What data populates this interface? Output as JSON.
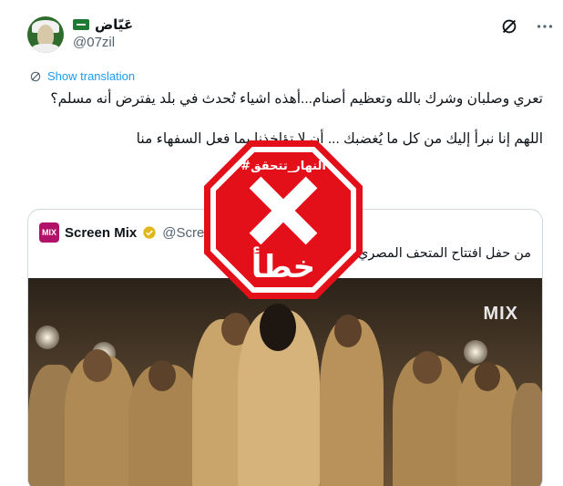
{
  "author": {
    "display_name": "عَيّاض",
    "handle": "@07zil"
  },
  "actions": {
    "show_translation": "Show translation"
  },
  "tweet": {
    "paragraph_1": "تعري وصلبان وشرك بالله وتعظيم أصنام...أهذه اشياء تُحدث في بلد يفترض أنه مسلم؟",
    "paragraph_2": "اللهم إنا نبرأ إليك من كل ما يُغضبك ... أن لا تؤاخذنا بما فعل السفهاء منا"
  },
  "quoted": {
    "logo_text": "MIX",
    "name": "Screen Mix",
    "handle": "@Scre",
    "text": "من حفل افتتاح المتحف المصري",
    "image_watermark": "MIX"
  },
  "stamp": {
    "tag": "#النهار_تتحقق",
    "verdict": "خطأ",
    "color": "#e3101a"
  },
  "colors": {
    "link": "#1d9bf0",
    "muted": "#536471",
    "border": "#cfd9de"
  }
}
